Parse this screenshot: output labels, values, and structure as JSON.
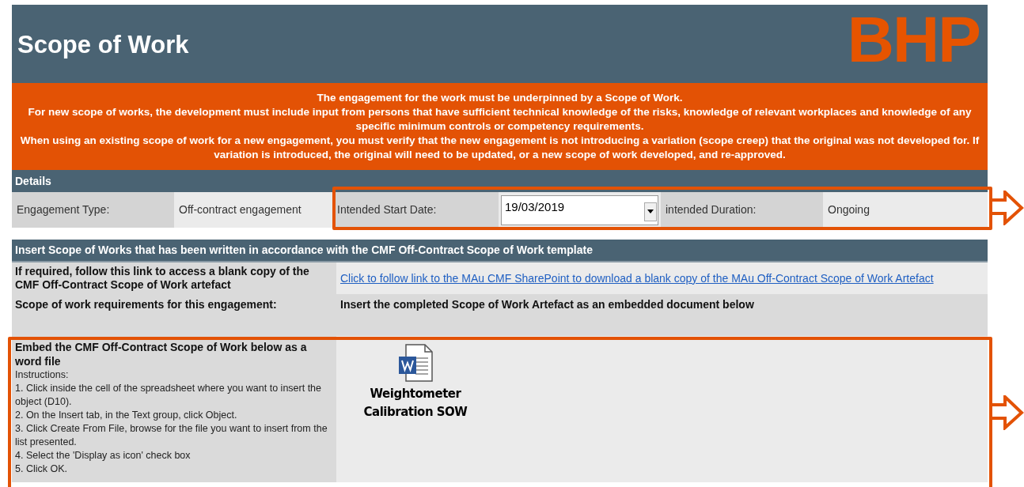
{
  "header": {
    "title": "Scope of Work",
    "logo": "BHP"
  },
  "notice": {
    "paragraphs": [
      "The engagement for the work must be underpinned by a Scope of Work.",
      "For new scope of works, the development must include input from persons that have sufficient technical knowledge of the risks, knowledge of relevant workplaces and knowledge of any specific minimum controls or competency requirements.",
      "When using an existing scope of work for a new engagement, you must verify that the new engagement is not introducing a variation (scope creep) that the original was not developed for.  If variation is introduced, the original will need to be updated, or a new scope of work developed, and re-approved."
    ]
  },
  "details": {
    "heading": "Details",
    "fields": [
      {
        "label": "Engagement Type:",
        "value": "Off-contract engagement",
        "kind": "text"
      },
      {
        "label": "Intended Start Date:",
        "value": "19/03/2019",
        "kind": "dropdown"
      },
      {
        "label": "intended Duration:",
        "value": "Ongoing",
        "kind": "text"
      }
    ]
  },
  "scope": {
    "heading": "Insert Scope of Works that has been written in accordance with the CMF Off-Contract Scope of Work template",
    "link_row": {
      "label": "If required, follow this link to access a blank copy of the CMF Off-Contract Scope of Work artefact",
      "link": "Click to follow link to the MAu CMF SharePoint to download a blank copy of the MAu Off-Contract Scope of Work Artefact"
    },
    "requirements_row": {
      "label": "Scope of work requirements for this engagement:",
      "value": "Insert the completed Scope of Work Artefact as an embedded document below"
    },
    "embed_row": {
      "title": "Embed the CMF Off-Contract Scope of Work below as a word file",
      "instructions": [
        "Instructions:",
        "1. Click inside the cell of the spreadsheet where you want to insert the object (D10).",
        "2. On the Insert tab, in the Text group, click Object.",
        "3. Click Create From File, browse for the file you want to insert from the list presented.",
        "4. Select the 'Display as icon' check box",
        "5. Click OK."
      ],
      "attachment": {
        "name": "Weightometer Calibration SOW"
      }
    }
  }
}
